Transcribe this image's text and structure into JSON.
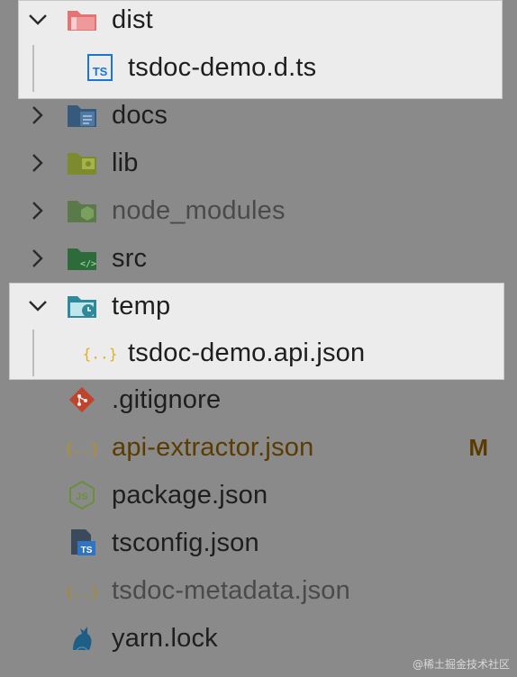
{
  "tree": {
    "dist": {
      "label": "dist",
      "expanded": true,
      "icon": "folder-open-red-icon"
    },
    "dist_file": {
      "label": "tsdoc-demo.d.ts",
      "icon": "typescript-file-icon"
    },
    "docs": {
      "label": "docs",
      "icon": "folder-docs-icon"
    },
    "lib": {
      "label": "lib",
      "icon": "folder-lib-icon"
    },
    "node_modules": {
      "label": "node_modules",
      "icon": "folder-node-icon"
    },
    "src": {
      "label": "src",
      "icon": "folder-src-icon"
    },
    "temp": {
      "label": "temp",
      "expanded": true,
      "icon": "folder-temp-icon"
    },
    "temp_file": {
      "label": "tsdoc-demo.api.json",
      "icon": "json-file-icon"
    },
    "gitignore": {
      "label": ".gitignore",
      "icon": "git-icon"
    },
    "api_extractor": {
      "label": "api-extractor.json",
      "badge": "M",
      "icon": "json-file-icon"
    },
    "package": {
      "label": "package.json",
      "icon": "nodejs-icon"
    },
    "tsconfig": {
      "label": "tsconfig.json",
      "icon": "tsconfig-icon"
    },
    "tsdoc_metadata": {
      "label": "tsdoc-metadata.json",
      "icon": "json-file-icon"
    },
    "yarn": {
      "label": "yarn.lock",
      "icon": "yarn-icon"
    }
  },
  "watermark": "@稀土掘金技术社区",
  "colors": {
    "background": "#8a8a8a",
    "highlight": "#ececec",
    "modified": "#5a3c00"
  }
}
